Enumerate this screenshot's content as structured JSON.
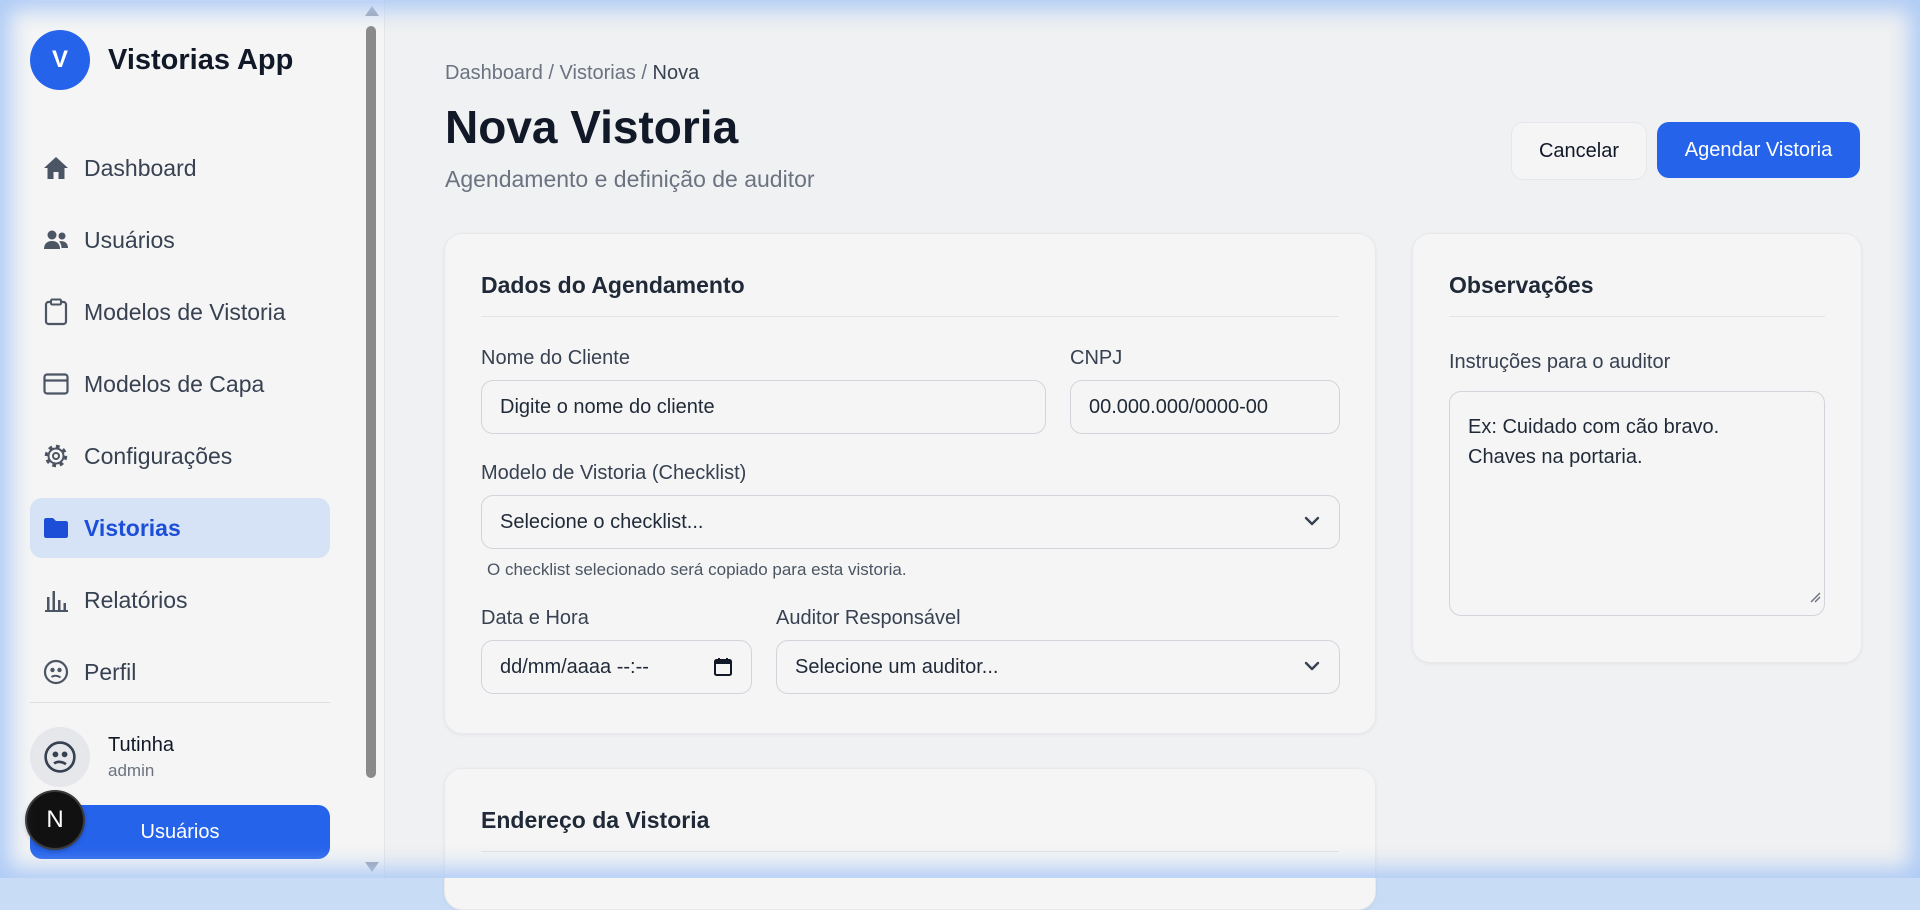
{
  "app": {
    "logo_letter": "V",
    "name": "Vistorias App"
  },
  "sidebar": {
    "items": [
      {
        "label": "Dashboard",
        "icon": "home-icon"
      },
      {
        "label": "Usuários",
        "icon": "users-icon"
      },
      {
        "label": "Modelos de Vistoria",
        "icon": "clipboard-icon"
      },
      {
        "label": "Modelos de Capa",
        "icon": "card-icon"
      },
      {
        "label": "Configurações",
        "icon": "gear-icon"
      },
      {
        "label": "Vistorias",
        "icon": "folder-icon",
        "active": true
      },
      {
        "label": "Relatórios",
        "icon": "bar-chart-icon"
      },
      {
        "label": "Perfil",
        "icon": "face-icon"
      }
    ],
    "user": {
      "name": "Tutinha",
      "role": "admin"
    },
    "bottom_button": "Usuários",
    "badge_letter": "N"
  },
  "header": {
    "breadcrumb": {
      "part1": "Dashboard",
      "sep": "/",
      "part2": "Vistorias",
      "current": "Nova"
    },
    "title": "Nova Vistoria",
    "subtitle": "Agendamento e definição de auditor",
    "cancel_label": "Cancelar",
    "primary_label": "Agendar Vistoria"
  },
  "schedule_card": {
    "title": "Dados do Agendamento",
    "client_label": "Nome do Cliente",
    "client_placeholder": "Digite o nome do cliente",
    "cnpj_label": "CNPJ",
    "cnpj_placeholder": "00.000.000/0000-00",
    "model_label": "Modelo de Vistoria (Checklist)",
    "model_value": "Selecione o checklist...",
    "model_hint": "O checklist selecionado será copiado para esta vistoria.",
    "date_label": "Data e Hora",
    "date_placeholder": "dd/mm/aaaa --:--",
    "auditor_label": "Auditor Responsável",
    "auditor_value": "Selecione um auditor..."
  },
  "notes_card": {
    "title": "Observações",
    "instructions_label": "Instruções para o auditor",
    "instructions_line1": "Ex: Cuidado com cão bravo.",
    "instructions_line2": "Chaves na portaria."
  },
  "address_card": {
    "title": "Endereço da Vistoria"
  },
  "colors": {
    "accent": "#2563eb",
    "active_bg": "#d6e3f6",
    "active_text": "#1d4ed8"
  }
}
